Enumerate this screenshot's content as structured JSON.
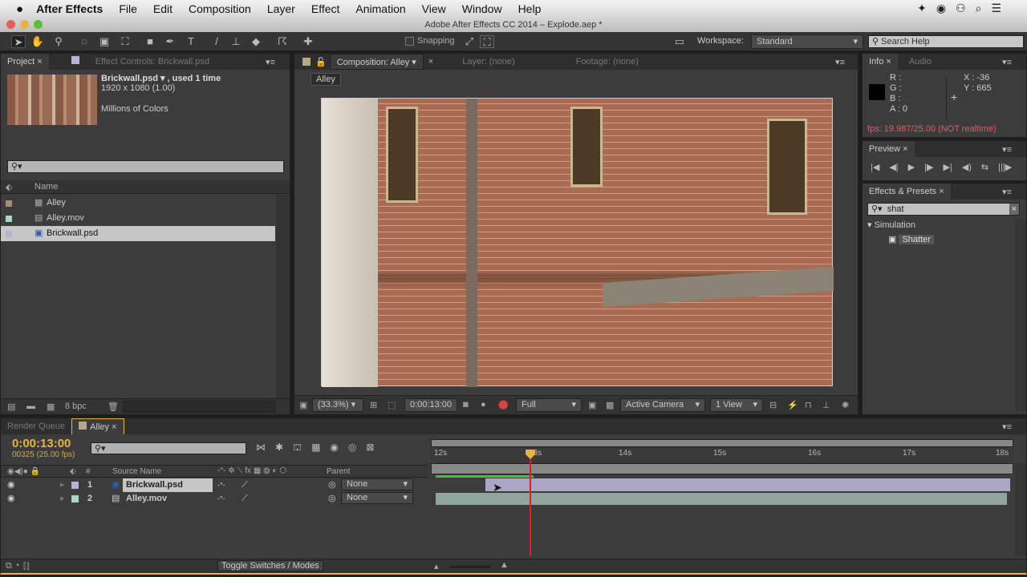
{
  "menubar": {
    "app": "After Effects",
    "items": [
      "File",
      "Edit",
      "Composition",
      "Layer",
      "Effect",
      "Animation",
      "View",
      "Window",
      "Help"
    ]
  },
  "window_title": "Adobe After Effects CC 2014 – Explode.aep *",
  "toolbar": {
    "snapping": "Snapping",
    "workspace_label": "Workspace:",
    "workspace": "Standard",
    "search_placeholder": "Search Help"
  },
  "project": {
    "tab": "Project",
    "effect_controls_tab": "Effect Controls: Brickwall.psd",
    "selected_name": "Brickwall.psd ▾ , used 1 time",
    "dimensions": "1920 x 1080 (1.00)",
    "colors": "Millions of Colors",
    "search_placeholder": "",
    "name_header": "Name",
    "items": [
      {
        "name": "Alley",
        "color": "#a08e6e"
      },
      {
        "name": "Alley.mov",
        "color": "#a08e6e"
      },
      {
        "name": "Brickwall.psd",
        "color": "#a08e6e"
      }
    ],
    "bpc": "8 bpc"
  },
  "composition": {
    "tab": "Composition: Alley",
    "layer_tab": "Layer: (none)",
    "footage_tab": "Footage: (none)",
    "breadcrumb": "Alley",
    "zoom": "(33.3%)",
    "timecode": "0:00:13:00",
    "resolution": "Full",
    "camera": "Active Camera",
    "views": "1 View"
  },
  "info": {
    "tab": "Info",
    "audio_tab": "Audio",
    "r": "R :",
    "g": "G :",
    "b": "B :",
    "a": "A : 0",
    "x": "X : -36",
    "y": "Y : 665",
    "fps": "fps: 19.987/25.00 (NOT realtime)"
  },
  "preview": {
    "tab": "Preview"
  },
  "effects": {
    "tab": "Effects & Presets",
    "search": "shat",
    "category": "Simulation",
    "effect": "Shatter"
  },
  "timeline": {
    "render_queue_tab": "Render Queue",
    "comp_tab": "Alley",
    "timecode": "0:00:13:00",
    "frame": "00325 (25.00 fps)",
    "headers": {
      "num": "#",
      "source": "Source Name",
      "parent": "Parent"
    },
    "layers": [
      {
        "num": "1",
        "name": "Brickwall.psd",
        "parent": "None",
        "label": "#b7b2d6",
        "bar": "#a9a7c4"
      },
      {
        "num": "2",
        "name": "Alley.mov",
        "parent": "None",
        "label": "#a8d6c8",
        "bar": "#8fa69c"
      }
    ],
    "ruler": [
      "12s",
      "13s",
      "14s",
      "15s",
      "16s",
      "17s",
      "18s"
    ],
    "toggle": "Toggle Switches / Modes",
    "accent": "#e8b43c",
    "playhead": "#e02020"
  }
}
